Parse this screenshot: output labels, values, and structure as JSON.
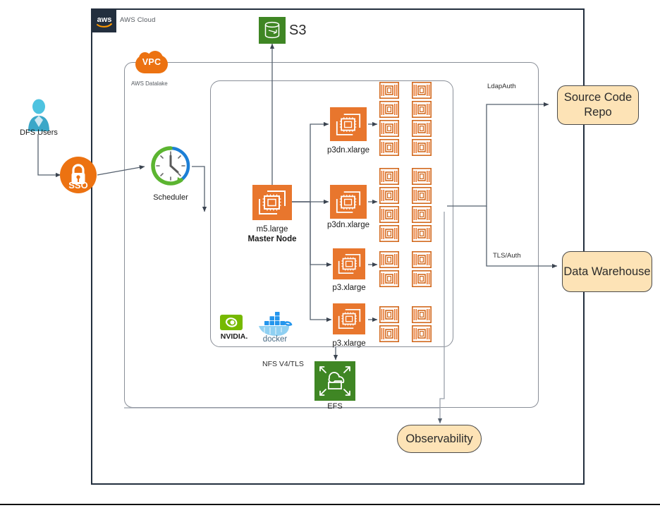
{
  "diagram": {
    "title": "AWS Cloud",
    "cloud_label": "AWS Cloud",
    "vpc_label": "VPC",
    "datalake_label": "AWS Datalake"
  },
  "colors": {
    "aws_navy": "#232f3e",
    "aws_orange": "#ec7211",
    "ec2_orange": "#e8762d",
    "s3_green": "#3f8624",
    "efs_green": "#3f8624",
    "peach": "#fde3b6",
    "wire_gray": "#55606e",
    "nvidia_green": "#76b900",
    "docker_blue": "#2496ed"
  },
  "external": {
    "users": {
      "label": "DFS Users",
      "icon": "user-icon"
    },
    "sso": {
      "label": "SSO",
      "icon": "lock-icon"
    },
    "s3": {
      "label": "S3",
      "icon": "s3-bucket-icon"
    }
  },
  "vpc": {
    "scheduler": {
      "label": "Scheduler",
      "icon": "clock-icon"
    },
    "master": {
      "instance_type": "m5.large",
      "role": "Master Node",
      "icon": "ec2-instance-icon"
    },
    "workers": [
      {
        "instance_type": "p3dn.xlarge",
        "gpu_count": 8,
        "icon": "ec2-instance-icon"
      },
      {
        "instance_type": "p3dn.xlarge",
        "gpu_count": 8,
        "icon": "ec2-instance-icon"
      },
      {
        "instance_type": "p3.xlarge",
        "gpu_count": 4,
        "icon": "ec2-instance-icon"
      },
      {
        "instance_type": "p3.xlarge",
        "gpu_count": 4,
        "icon": "ec2-instance-icon"
      }
    ],
    "runtime_logos": [
      {
        "name": "NVIDIA",
        "icon": "nvidia-logo"
      },
      {
        "name": "docker",
        "icon": "docker-logo"
      }
    ],
    "efs": {
      "label": "EFS",
      "protocol_label": "NFS V4/TLS",
      "icon": "efs-icon"
    }
  },
  "integrations": [
    {
      "label": "Source Code Repo",
      "edge_label": "LdapAuth"
    },
    {
      "label": "Data Warehouse",
      "edge_label": "TLS/Auth"
    },
    {
      "label": "Observability",
      "edge_label": ""
    }
  ]
}
